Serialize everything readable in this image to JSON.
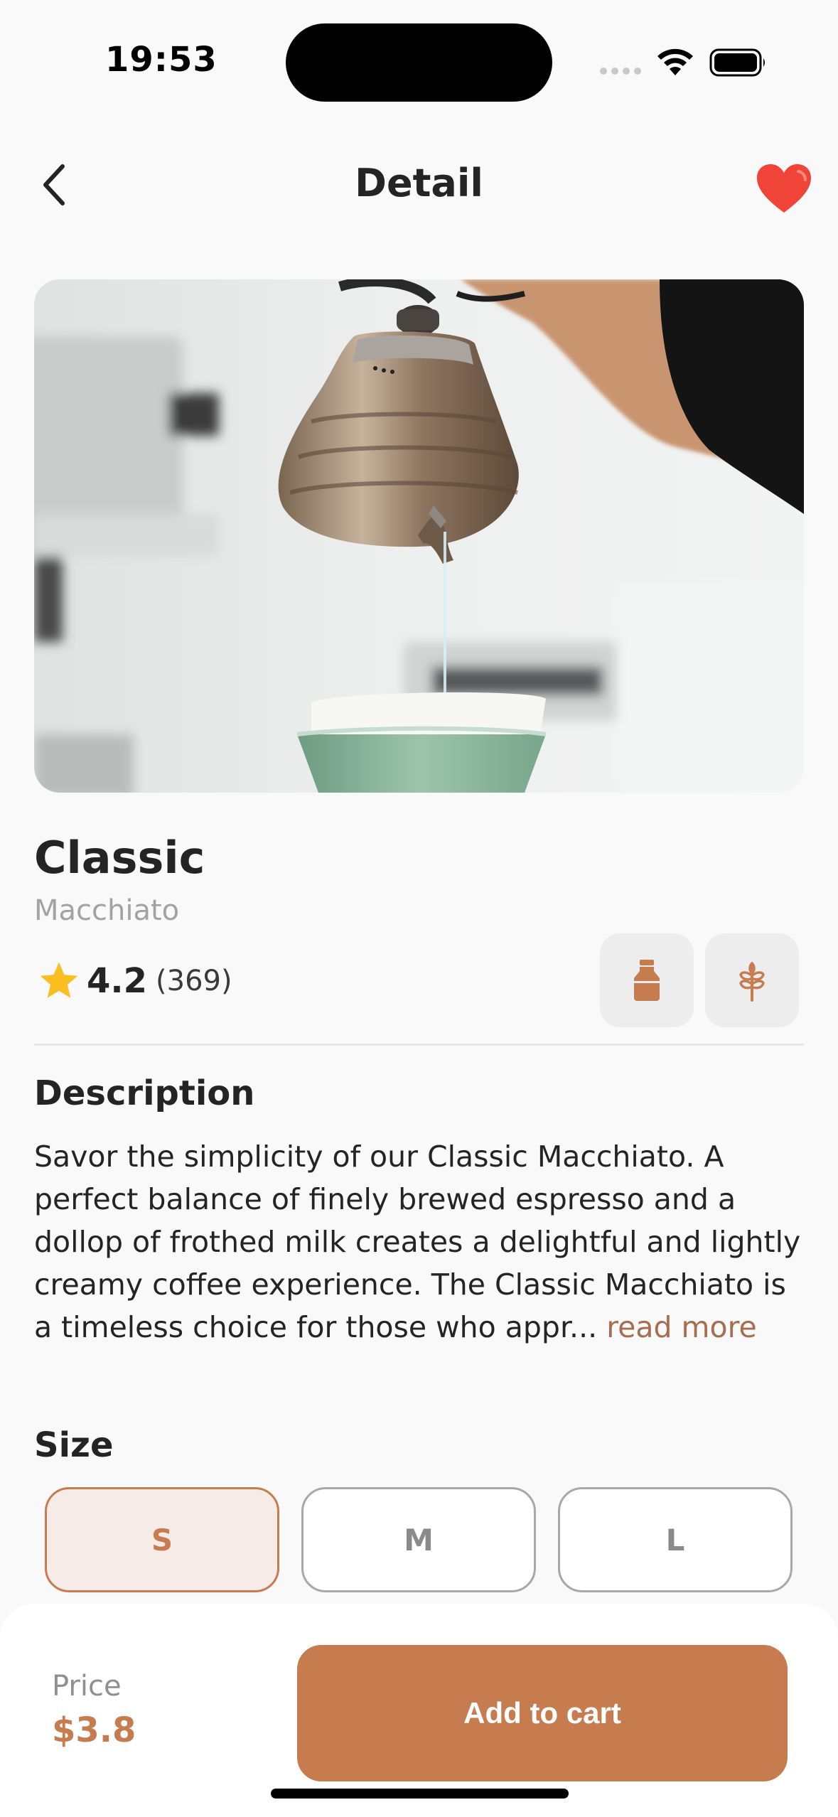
{
  "status_bar": {
    "time": "19:53"
  },
  "header": {
    "title": "Detail"
  },
  "product": {
    "name": "Classic",
    "subtitle": "Macchiato",
    "rating": "4.2",
    "rating_count": "(369)"
  },
  "description": {
    "title": "Description",
    "text": "Savor the simplicity of our Classic Macchiato. A perfect balance of finely brewed espresso and a dollop of frothed milk creates a delightful and lightly creamy coffee experience. The Classic Macchiato is a timeless choice for those who appr...",
    "read_more": "read more"
  },
  "size": {
    "title": "Size",
    "options": [
      "S",
      "M",
      "L"
    ],
    "selected": "S"
  },
  "footer": {
    "price_label": "Price",
    "price": "$3.8",
    "add_to_cart_label": "Add to cart"
  },
  "colors": {
    "accent": "#c67c4e",
    "favorite": "#f04438",
    "star": "#fbbe21"
  },
  "icons": {
    "back": "chevron-left-icon",
    "favorite": "heart-icon",
    "rating": "star-icon",
    "badge_1": "milk-bottle-icon",
    "badge_2": "wheat-icon"
  }
}
